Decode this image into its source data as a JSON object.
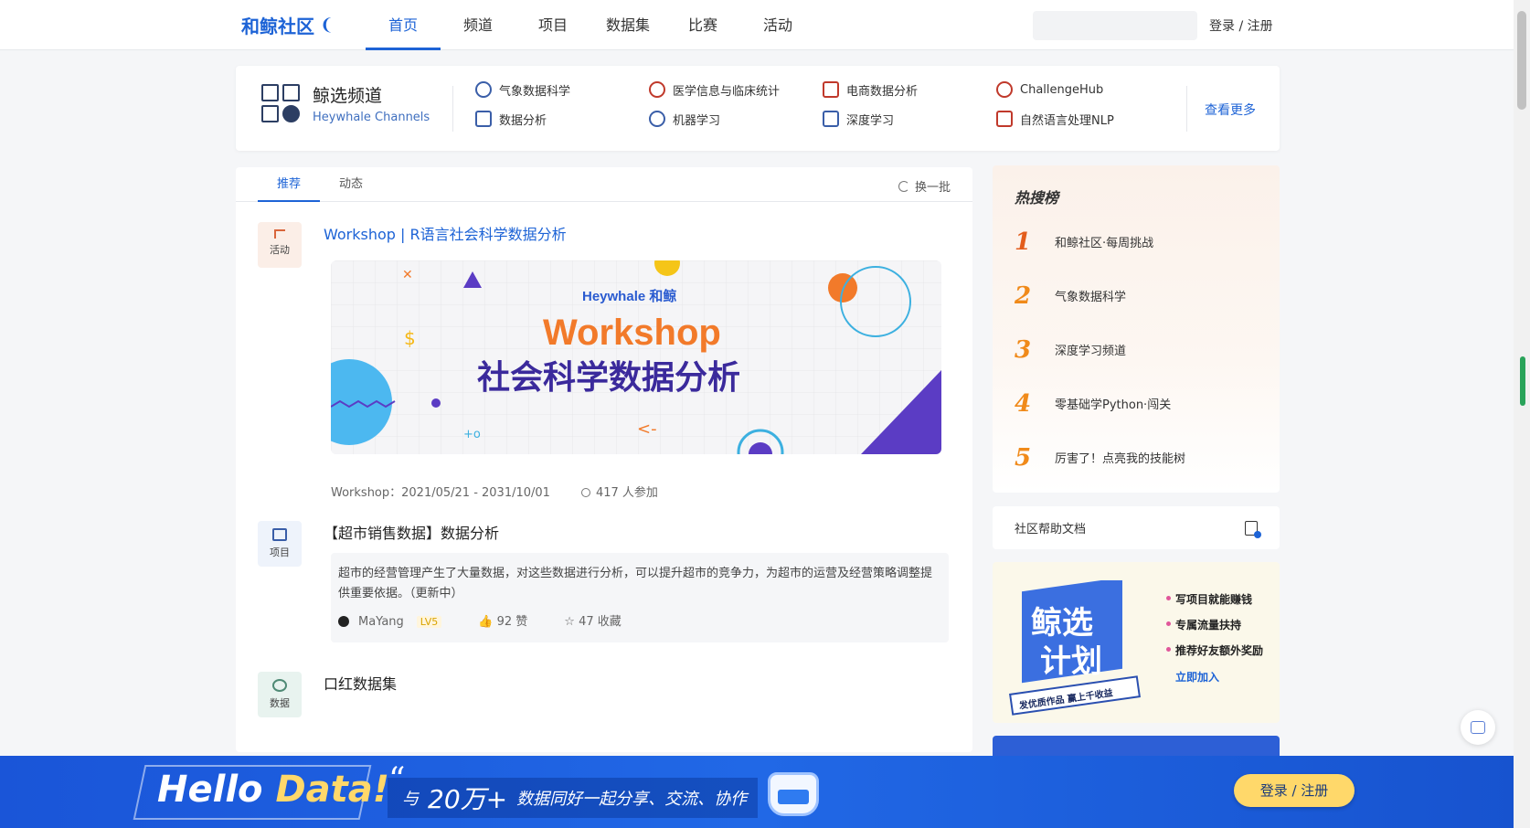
{
  "header": {
    "logo": "和鲸社区",
    "nav": [
      "首页",
      "频道",
      "项目",
      "数据集",
      "比赛",
      "活动"
    ],
    "active_nav": "首页",
    "search_placeholder": "",
    "login": "登录 / 注册"
  },
  "channels": {
    "title": "鲸选频道",
    "subtitle": "Heywhale Channels",
    "items": [
      "气象数据科学",
      "医学信息与临床统计",
      "电商数据分析",
      "ChallengeHub",
      "数据分析",
      "机器学习",
      "深度学习",
      "自然语言处理NLP"
    ],
    "more": "查看更多"
  },
  "feed": {
    "tabs": [
      "推荐",
      "动态"
    ],
    "active_tab": "推荐",
    "refresh": "换一批",
    "posts": [
      {
        "type": "活动",
        "title": "Workshop | R语言社会科学数据分析",
        "banner_brand": "Heywhale 和鲸",
        "banner_title": "Workshop",
        "banner_subtitle": "社会科学数据分析",
        "dates": "Workshop：2021/05/21 - 2031/10/01",
        "participants": "417 人参加"
      },
      {
        "type": "项目",
        "title": "【超市销售数据】数据分析",
        "excerpt": "超市的经营管理产生了大量数据，对这些数据进行分析，可以提升超市的竞争力，为超市的运营及经营策略调整提供重要依据。（更新中）",
        "author": "MaYang",
        "level": "LV5",
        "likes": "92 赞",
        "favorites": "47 收藏"
      },
      {
        "type": "数据",
        "title": "口红数据集"
      }
    ]
  },
  "hot": {
    "title": "热搜榜",
    "items": [
      {
        "rank": "1",
        "text": "和鲸社区·每周挑战"
      },
      {
        "rank": "2",
        "text": "气象数据科学"
      },
      {
        "rank": "3",
        "text": "深度学习频道"
      },
      {
        "rank": "4",
        "text": "零基础学Python·闯关"
      },
      {
        "rank": "5",
        "text": "厉害了！点亮我的技能树"
      }
    ]
  },
  "help": {
    "label": "社区帮助文档"
  },
  "promo": {
    "art_text_1": "鲸选",
    "art_text_2": "计划",
    "art_ribbon": "发优质作品 赢上千收益",
    "points": [
      "写项目就能赚钱",
      "专属流量扶持",
      "推荐好友额外奖励"
    ],
    "join": "立即加入"
  },
  "bottom_bar": {
    "hello_a": "Hello ",
    "hello_b": "Data!",
    "quote_mark": "“",
    "tag_pre": "与",
    "tag_num": "20万+",
    "tag_post": "数据同好一起分享、交流、协作",
    "login": "登录 / 注册"
  },
  "colors": {
    "brand": "#1d63d6",
    "hot": "#f08a1a",
    "bottom": "#1a55d8",
    "cta": "#ffd86a"
  }
}
